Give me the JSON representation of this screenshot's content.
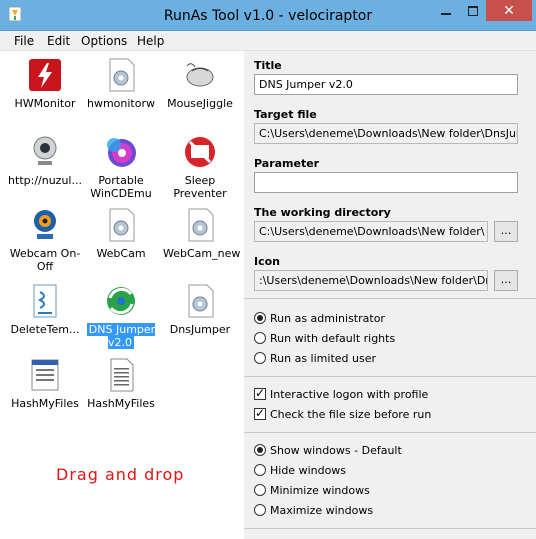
{
  "window": {
    "title": "RunAs Tool v1.0 - velociraptor",
    "close_glyph": "✕"
  },
  "menu": [
    "File",
    "Edit",
    "Options",
    "Help"
  ],
  "items": [
    {
      "label": "HWMonitor",
      "icon": "hwmonitor-icon"
    },
    {
      "label": "hwmonitorw",
      "icon": "generic-exe-icon"
    },
    {
      "label": "MouseJiggle",
      "icon": "mouse-icon"
    },
    {
      "label": "http://nuzul...",
      "icon": "webcam-icon"
    },
    {
      "label": "Portable WinCDEmu",
      "icon": "disc-icon"
    },
    {
      "label": "Sleep Preventer",
      "icon": "no-sleep-icon"
    },
    {
      "label": "Webcam On-Off",
      "icon": "webcam-onoff-icon"
    },
    {
      "label": "WebCam",
      "icon": "generic-exe-icon"
    },
    {
      "label": "WebCam_new",
      "icon": "generic-exe-icon"
    },
    {
      "label": "DeleteTem...",
      "icon": "script-icon"
    },
    {
      "label": "DNS Jumper v2.0",
      "icon": "dns-jumper-icon"
    },
    {
      "label": "DnsJumper",
      "icon": "generic-exe-icon"
    },
    {
      "label": "HashMyFiles",
      "icon": "hashmyfiles-icon"
    },
    {
      "label": "HashMyFiles",
      "icon": "text-file-icon"
    }
  ],
  "drag_hint": "Drag and drop",
  "form": {
    "title_label": "Title",
    "title_value": "DNS Jumper v2.0",
    "target_label": "Target file",
    "target_value": "C:\\Users\\deneme\\Downloads\\New folder\\DnsJumper.",
    "param_label": "Parameter",
    "param_value": "",
    "workdir_label": "The working directory",
    "workdir_value": "C:\\Users\\deneme\\Downloads\\New folder\\",
    "icon_label": "Icon",
    "icon_value": ":\\Users\\deneme\\Downloads\\New folder\\DnsJum",
    "browse_label": "..."
  },
  "run_options": [
    "Run as administrator",
    "Run with default rights",
    "Run as limited user"
  ],
  "run_selected": 0,
  "checks": [
    {
      "label": "Interactive logon with profile",
      "checked": true
    },
    {
      "label": "Check the file size before run",
      "checked": true
    }
  ],
  "window_options": [
    "Show windows - Default",
    "Hide windows",
    "Minimize windows",
    "Maximize windows"
  ],
  "window_selected": 0
}
